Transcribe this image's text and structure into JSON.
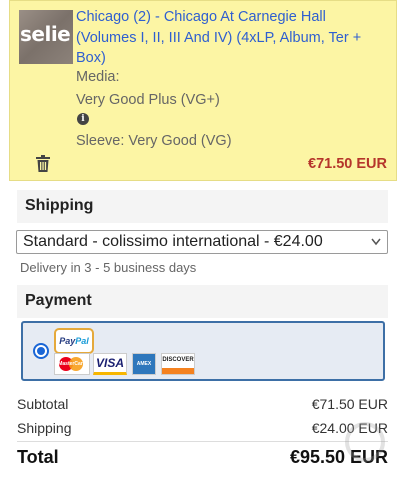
{
  "item": {
    "thumb_text": "selie",
    "title": "Chicago (2) - Chicago At Carnegie Hall (Volumes I, II, III And IV) (4xLP, Album, Ter + Box)",
    "media_label": "Media:",
    "media_value": "Very Good Plus (VG+)",
    "sleeve_label": "Sleeve: Very Good (VG)",
    "price": "€71.50 EUR"
  },
  "shipping": {
    "heading": "Shipping",
    "selected_option": "Standard - colissimo international - €24.00",
    "delivery_note": "Delivery in 3 - 5 business days"
  },
  "payment": {
    "heading": "Payment",
    "methods": {
      "paypal_a": "Pay",
      "paypal_b": "Pal",
      "mastercard": "MasterCard",
      "visa": "VISA",
      "amex": "AMEX",
      "discover": "DISCOVER"
    }
  },
  "summary": {
    "subtotal_label": "Subtotal",
    "subtotal_value": "€71.50 EUR",
    "shipping_label": "Shipping",
    "shipping_value": "€24.00 EUR",
    "total_label": "Total",
    "total_value": "€95.50 EUR"
  },
  "colors": {
    "item_bg": "#fcf5a4",
    "link": "#2f5fd0",
    "price": "#b5352b",
    "payment_border": "#3d6fa6",
    "radio": "#1a66d6"
  }
}
